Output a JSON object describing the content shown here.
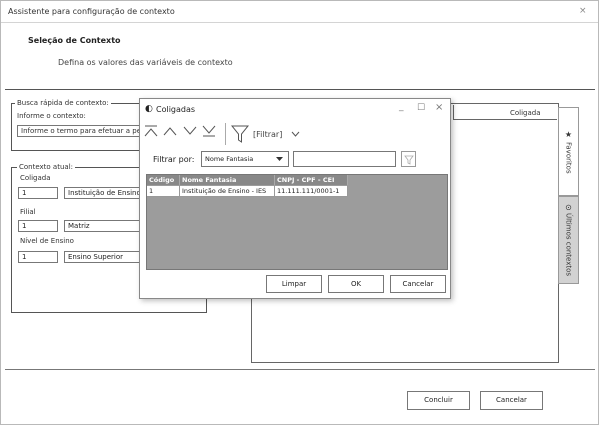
{
  "window": {
    "title": "Assistente para configuração de contexto"
  },
  "header": {
    "title": "Seleção de Contexto",
    "subtitle": "Defina os valores das variáveis de contexto"
  },
  "quick_search": {
    "legend": "Busca rápida de contexto:",
    "label": "Informe o contexto:",
    "placeholder": "Informe o termo para efetuar a pesquisa"
  },
  "current_context": {
    "legend": "Contexto atual:",
    "coligada": {
      "label": "Coligada",
      "code": "1",
      "name": "Instituição de Ensino - IES"
    },
    "filial": {
      "label": "Filial",
      "code": "1",
      "name": "Matriz"
    },
    "nivel": {
      "label": "Nível de Ensino",
      "code": "1",
      "name": "Ensino Superior"
    }
  },
  "right_panel": {
    "column_header": "Coligada"
  },
  "side_tabs": {
    "favoritos": "Favoritos",
    "ultimos": "Últimos contextos"
  },
  "footer": {
    "concluir": "Concluir",
    "cancelar": "Cancelar"
  },
  "dialog": {
    "title": "Coligadas",
    "controls": {
      "minimize": "_",
      "maximize": "☐",
      "close": "×"
    },
    "filter_menu": "[Filtrar]",
    "filter_label": "Filtrar por:",
    "filter_field": "Nome Fantasia",
    "filter_value": "",
    "columns": [
      "Código",
      "Nome Fantasia",
      "CNPJ - CPF - CEI"
    ],
    "rows": [
      {
        "codigo": "1",
        "nome": "Instituição de Ensino - IES",
        "cnpj": "11.111.111/0001-1"
      }
    ],
    "buttons": {
      "limpar": "Limpar",
      "ok": "OK",
      "cancelar": "Cancelar"
    }
  }
}
